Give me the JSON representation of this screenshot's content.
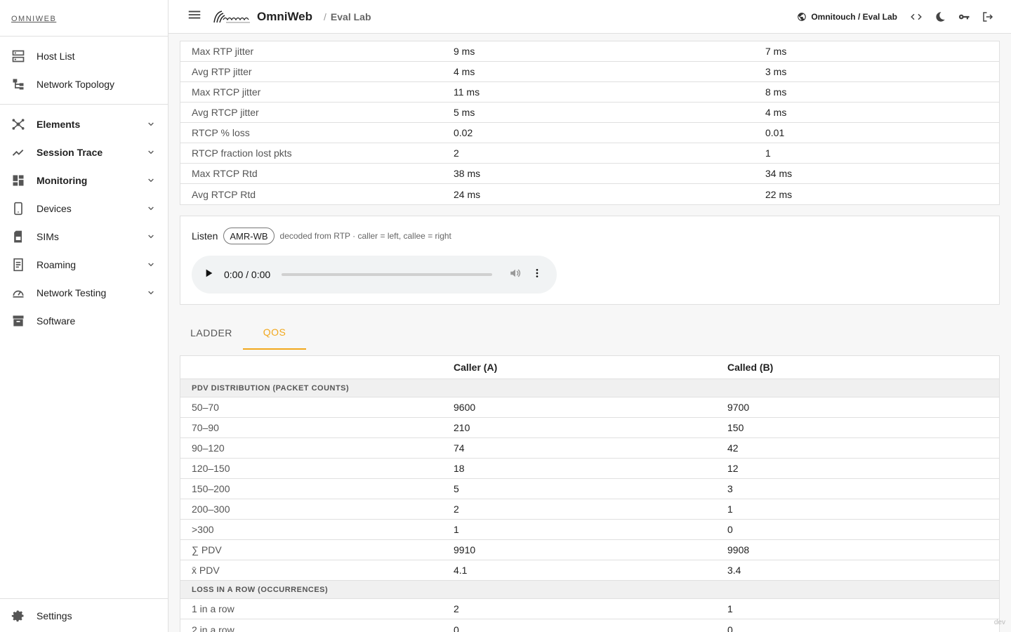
{
  "sidebar": {
    "brand": "OMNIWEB",
    "top_items": [
      {
        "label": "Host List"
      },
      {
        "label": "Network Topology"
      }
    ],
    "groups": [
      {
        "label": "Elements"
      },
      {
        "label": "Session Trace"
      },
      {
        "label": "Monitoring"
      },
      {
        "label": "Devices"
      },
      {
        "label": "SIMs"
      },
      {
        "label": "Roaming"
      },
      {
        "label": "Network Testing"
      },
      {
        "label": "Software"
      }
    ],
    "settings": "Settings"
  },
  "header": {
    "app_name": "OmniWeb",
    "breadcrumb": "Eval Lab",
    "tenant": "Omnitouch / Eval Lab"
  },
  "top_table": [
    {
      "label": "Max RTP jitter",
      "a": "9 ms",
      "b": "7 ms"
    },
    {
      "label": "Avg RTP jitter",
      "a": "4 ms",
      "b": "3 ms"
    },
    {
      "label": "Max RTCP jitter",
      "a": "11 ms",
      "b": "8 ms"
    },
    {
      "label": "Avg RTCP jitter",
      "a": "5 ms",
      "b": "4 ms"
    },
    {
      "label": "RTCP % loss",
      "a": "0.02",
      "b": "0.01"
    },
    {
      "label": "RTCP fraction lost pkts",
      "a": "2",
      "b": "1"
    },
    {
      "label": "Max RTCP Rtd",
      "a": "38 ms",
      "b": "34 ms"
    },
    {
      "label": "Avg RTCP Rtd",
      "a": "24 ms",
      "b": "22 ms"
    }
  ],
  "listen": {
    "title": "Listen",
    "codec": "AMR-WB",
    "note": "decoded from RTP · caller = left, callee = right",
    "time": "0:00 / 0:00"
  },
  "tabs": [
    {
      "label": "LADDER"
    },
    {
      "label": "QOS"
    }
  ],
  "qos": {
    "col_a": "Caller (A)",
    "col_b": "Called (B)",
    "section1": "PDV DISTRIBUTION (PACKET COUNTS)",
    "pdv_rows": [
      {
        "label": "50–70",
        "a": "9600",
        "b": "9700"
      },
      {
        "label": "70–90",
        "a": "210",
        "b": "150"
      },
      {
        "label": "90–120",
        "a": "74",
        "b": "42"
      },
      {
        "label": "120–150",
        "a": "18",
        "b": "12"
      },
      {
        "label": "150–200",
        "a": "5",
        "b": "3"
      },
      {
        "label": "200–300",
        "a": "2",
        "b": "1"
      },
      {
        "label": ">300",
        "a": "1",
        "b": "0"
      },
      {
        "label": "∑ PDV",
        "a": "9910",
        "b": "9908"
      },
      {
        "label": "x̄ PDV",
        "a": "4.1",
        "b": "3.4"
      }
    ],
    "section2": "LOSS IN A ROW (OCCURRENCES)",
    "loss_rows": [
      {
        "label": "1 in a row",
        "a": "2",
        "b": "1"
      },
      {
        "label": "2 in a row",
        "a": "0",
        "b": "0"
      }
    ]
  },
  "dev_tag": "dev"
}
